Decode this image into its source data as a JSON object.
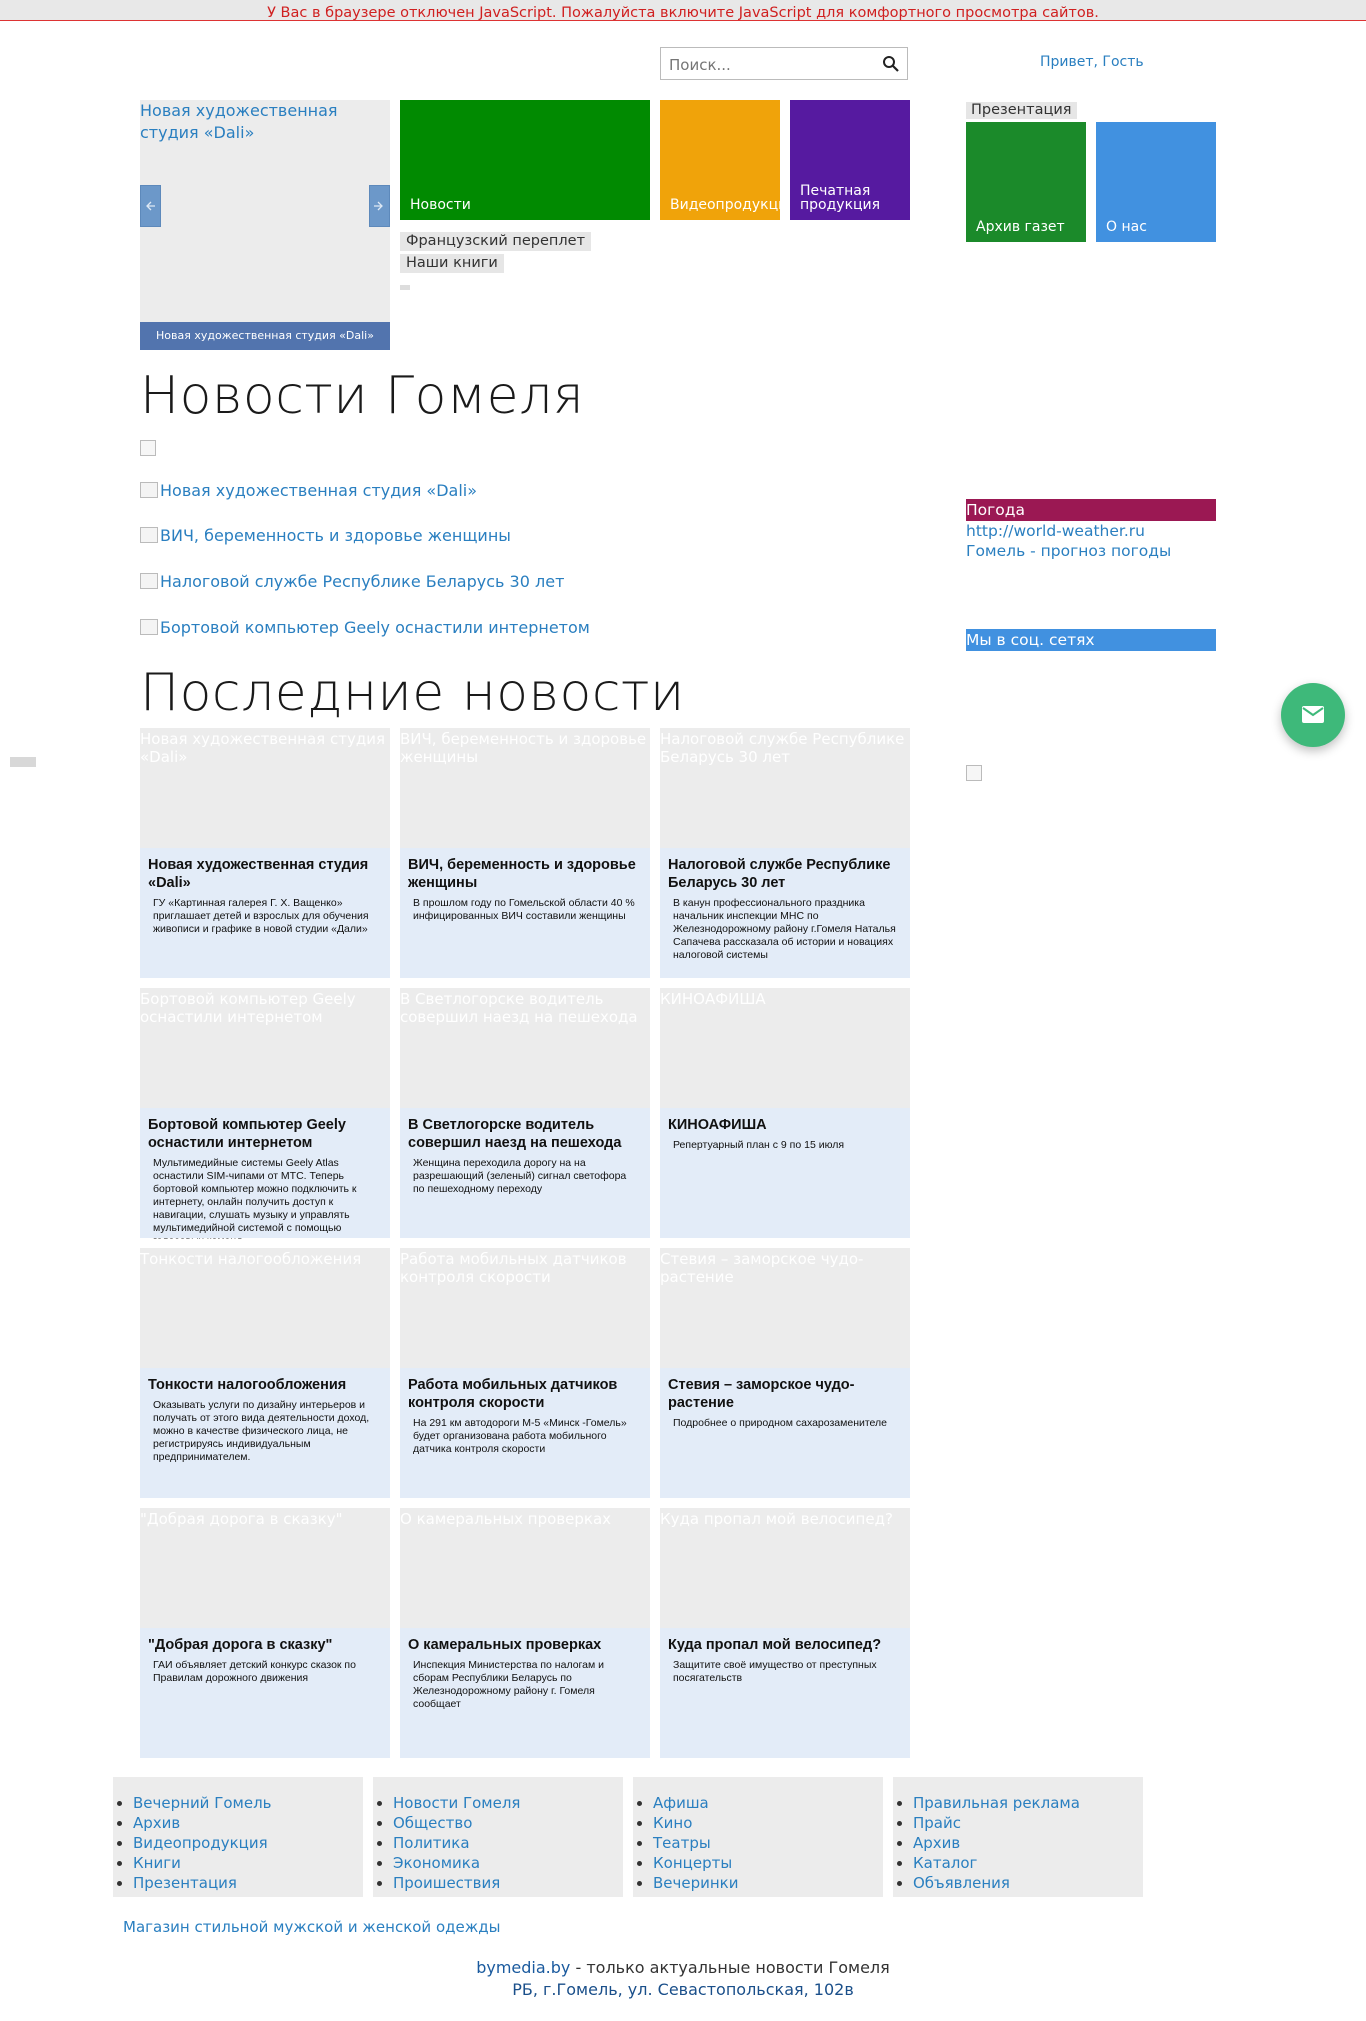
{
  "notice": "У Вас в браузере отключен JavaScript. Пожалуйста включите JavaScript для комфортного просмотра сайтов.",
  "search": {
    "placeholder": "Поиск..."
  },
  "greeting": "Привет, Гость",
  "slider": {
    "image_alt": "Новая художественная студия «Dali»",
    "caption": "Новая художественная студия «Dali»"
  },
  "tiles": {
    "news": "Новости",
    "video": "Видеопродукция",
    "print": "Печатная продукция",
    "archive": "Архив газет",
    "about": "О нас"
  },
  "buttons": {
    "french_binding": "Французский переплет",
    "our_books": "Наши книги",
    "presentation": "Презентация"
  },
  "headings": {
    "gomel_news": "Новости Гомеля",
    "latest_news": "Последние новости"
  },
  "gomel_news_links": [
    "Новая художественная студия «Dali»",
    "ВИЧ, беременность и здоровье женщины",
    "Налоговой службе Республике Беларусь 30 лет",
    "Бортовой компьютер Geely оснастили интернетом"
  ],
  "weather": {
    "heading": "Погода",
    "link1": "http://world-weather.ru",
    "link2": "Гомель - прогноз погоды"
  },
  "social": {
    "heading": "Мы в соц. сетях"
  },
  "cards": [
    {
      "alt": "Новая художественная студия «Dali»",
      "title": "Новая художественная студия «Dali»",
      "desc": "ГУ «Картинная галерея Г. Х. Ващенко» приглашает детей и взрослых для обучения живописи и графике в новой студии «Дали»"
    },
    {
      "alt": "ВИЧ, беременность и здоровье женщины",
      "title": "ВИЧ, беременность и здоровье женщины",
      "desc": "В прошлом году по Гомельской области 40 % инфицированных ВИЧ составили женщины"
    },
    {
      "alt": "Налоговой службе Республике Беларусь 30 лет",
      "title": "Налоговой службе Республике Беларусь 30 лет",
      "desc": "В канун профессионального праздника начальник инспекции МНС по Железнодорожному району г.Гомеля Наталья Сапачева рассказала об истории и новациях налоговой системы"
    },
    {
      "alt": "Бортовой компьютер Geely оснастили интернетом",
      "title": "Бортовой компьютер Geely оснастили интернетом",
      "desc": "Мультимедийные системы Geely Atlas оснастили SIM-чипами от МТС. Теперь бортовой компьютер можно подключить к интернету, онлайн получить доступ к навигации, слушать музыку и управлять мультимедийной системой с помощью голосовых команд"
    },
    {
      "alt": "В Светлогорске водитель совершил наезд на пешехода",
      "title": "В Светлогорске водитель совершил наезд на пешехода",
      "desc": "Женщина переходила дорогу на на разрешающий (зеленый) сигнал светофора по пешеходному переходу"
    },
    {
      "alt": "КИНОАФИША",
      "title": "КИНОАФИША",
      "desc": "Репертуарный план с 9 по 15 июля"
    },
    {
      "alt": "Тонкости налогообложения",
      "title": "Тонкости налогообложения",
      "desc": "Оказывать услуги по дизайну интерьеров и получать от этого вида деятельности доход, можно в качестве физического лица, не регистрируясь индивидуальным предпринимателем."
    },
    {
      "alt": "Работа мобильных датчиков контроля скорости",
      "title": "Работа мобильных датчиков контроля скорости",
      "desc": "На 291 км автодороги М-5 «Минск -Гомель» будет организована работа мобильного датчика контроля скорости"
    },
    {
      "alt": "Стевия – заморское чудо-растение",
      "title": "Стевия – заморское чудо-растение",
      "desc": "Подробнее о природном сахарозаменителе"
    },
    {
      "alt": "\"Добрая дорога в сказку\"",
      "title": "\"Добрая дорога в сказку\"",
      "desc": "ГАИ объявляет детский конкурс сказок по Правилам дорожного движения"
    },
    {
      "alt": "О камеральных проверках",
      "title": "О камеральных проверках",
      "desc": "Инспекция Министерства по налогам и сборам Республики Беларусь по Железнодорожному району г. Гомеля сообщает"
    },
    {
      "alt": "Куда пропал мой велосипед?",
      "title": "Куда пропал мой велосипед?",
      "desc": "Защитите своё имущество от преступных посягательств"
    }
  ],
  "footer_menus": [
    [
      "Вечерний Гомель",
      "Архив",
      "Видеопродукция",
      "Книги",
      "Презентация"
    ],
    [
      "Новости Гомеля",
      "Общество",
      "Политика",
      "Экономика",
      "Проишествия"
    ],
    [
      "Афиша",
      "Кино",
      "Театры",
      "Концерты",
      "Вечеринки"
    ],
    [
      "Правильная реклама",
      "Прайс",
      "Архив",
      "Каталог",
      "Объявления"
    ]
  ],
  "shop_link": "Магазин стильной мужской и женской одежды",
  "footer": {
    "site": "bymedia.by",
    "tagline": " - только актуальные новости Гомеля",
    "address": "РБ, г.Гомель, ул. Севастопольская, 102в"
  },
  "colors": {
    "news_tile": "#018a01",
    "video_tile": "#f0a30a",
    "print_tile": "#561aa0",
    "archive_tile": "#1b8a2a",
    "about_tile": "#4191e0",
    "weather_head": "#9b1853",
    "social_head": "#4191e0",
    "fab": "#3eb97a",
    "slider_caption": "#5274ae"
  },
  "icons": [
    "search-icon",
    "arrow-left-icon",
    "arrow-right-icon",
    "mail-icon"
  ]
}
